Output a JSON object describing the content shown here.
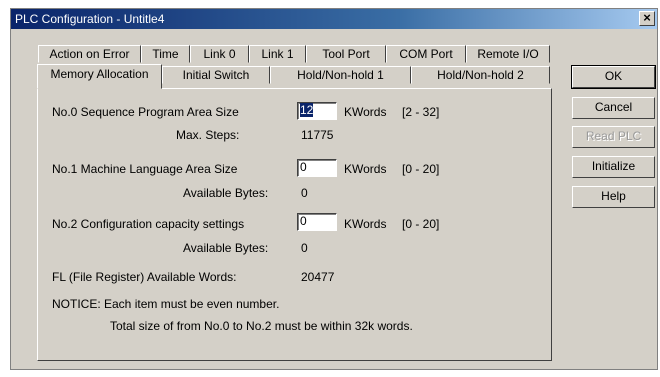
{
  "window": {
    "title": "PLC Configuration - Untitle4",
    "close_glyph": "×"
  },
  "tabs": {
    "back": [
      "Action on Error",
      "Time",
      "Link 0",
      "Link 1",
      "Tool Port",
      "COM Port",
      "Remote I/O"
    ],
    "front": [
      "Memory Allocation",
      "Initial Switch",
      "Hold/Non-hold 1",
      "Hold/Non-hold 2"
    ],
    "active": "Memory Allocation"
  },
  "memory": {
    "no0_label": "No.0 Sequence Program Area Size",
    "no0_value": "12",
    "no0_unit": "KWords",
    "no0_range": "[2 - 32]",
    "max_steps_label": "Max. Steps:",
    "max_steps_value": "11775",
    "no1_label": "No.1 Machine Language Area Size",
    "no1_value": "0",
    "no1_unit": "KWords",
    "no1_range": "[0 - 20]",
    "avail1_label": "Available Bytes:",
    "avail1_value": "0",
    "no2_label": "No.2 Configuration capacity settings",
    "no2_value": "0",
    "no2_unit": "KWords",
    "no2_range": "[0 - 20]",
    "avail2_label": "Available Bytes:",
    "avail2_value": "0",
    "fl_label": "FL (File Register) Available Words:",
    "fl_value": "20477",
    "notice1": "NOTICE: Each item must be even number.",
    "notice2": "Total size of from No.0 to No.2 must be within 32k words."
  },
  "buttons": {
    "ok": "OK",
    "cancel": "Cancel",
    "read_plc": "Read PLC",
    "initialize": "Initialize",
    "help": "Help"
  }
}
